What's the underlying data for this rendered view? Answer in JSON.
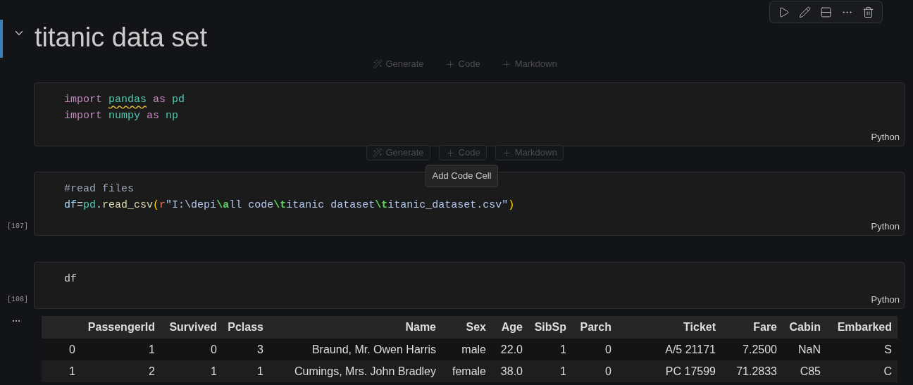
{
  "heading_cell": {
    "title": "titanic data set",
    "expanded": true,
    "selected": true
  },
  "insert_toolbars": [
    {
      "highlighted": false,
      "buttons": [
        {
          "kind": "generate",
          "label": "Generate"
        },
        {
          "kind": "add",
          "label": "Code"
        },
        {
          "kind": "add",
          "label": "Markdown"
        }
      ]
    },
    {
      "highlighted": true,
      "tooltip": "Add Code Cell",
      "buttons": [
        {
          "kind": "generate",
          "label": "Generate"
        },
        {
          "kind": "add",
          "label": "Code"
        },
        {
          "kind": "add",
          "label": "Markdown"
        }
      ]
    }
  ],
  "cells": [
    {
      "language": "Python",
      "lines": [
        [
          {
            "kind": "keyword",
            "text": "import "
          },
          {
            "kind": "module",
            "text": "pandas",
            "warning": true
          },
          {
            "kind": "keyword",
            "text": " as "
          },
          {
            "kind": "module",
            "text": "pd"
          }
        ],
        [
          {
            "kind": "keyword",
            "text": "import "
          },
          {
            "kind": "module",
            "text": "numpy",
            "warning": false
          },
          {
            "kind": "keyword",
            "text": " as "
          },
          {
            "kind": "module",
            "text": "np"
          }
        ]
      ]
    },
    {
      "execution_count": "[107]",
      "language": "Python",
      "lines": [
        [
          {
            "kind": "comment",
            "text": "#read files"
          }
        ],
        [
          {
            "kind": "variable",
            "text": "df"
          },
          {
            "kind": "plain",
            "text": "="
          },
          {
            "kind": "module",
            "text": "pd"
          },
          {
            "kind": "plain",
            "text": "."
          },
          {
            "kind": "function",
            "text": "read_csv"
          },
          {
            "kind": "paren",
            "text": "("
          },
          {
            "kind": "prefix",
            "text": "r"
          },
          {
            "kind": "string",
            "text": "\"I:\\depi"
          },
          {
            "kind": "escape",
            "text": "\\a"
          },
          {
            "kind": "string",
            "text": "ll code"
          },
          {
            "kind": "escape",
            "text": "\\t"
          },
          {
            "kind": "string",
            "text": "itanic dataset"
          },
          {
            "kind": "escape",
            "text": "\\t"
          },
          {
            "kind": "string",
            "text": "itanic_dataset.csv\""
          },
          {
            "kind": "paren",
            "text": ")"
          }
        ]
      ]
    },
    {
      "execution_count": "[108]",
      "language": "Python",
      "lines": [
        [
          {
            "kind": "plain",
            "text": "df"
          }
        ]
      ]
    }
  ],
  "output": {
    "table": {
      "columns": [
        "PassengerId",
        "Survived",
        "Pclass",
        "Name",
        "Sex",
        "Age",
        "SibSp",
        "Parch",
        "Ticket",
        "Fare",
        "Cabin",
        "Embarked"
      ],
      "rows": [
        {
          "index": "0",
          "cells": [
            "1",
            "0",
            "3",
            "Braund, Mr. Owen Harris",
            "male",
            "22.0",
            "1",
            "0",
            "A/5 21171",
            "7.2500",
            "NaN",
            "S"
          ]
        },
        {
          "index": "1",
          "cells": [
            "2",
            "1",
            "1",
            "Cumings, Mrs. John Bradley",
            "female",
            "38.0",
            "1",
            "0",
            "PC 17599",
            "71.2833",
            "C85",
            "C"
          ]
        }
      ]
    }
  }
}
